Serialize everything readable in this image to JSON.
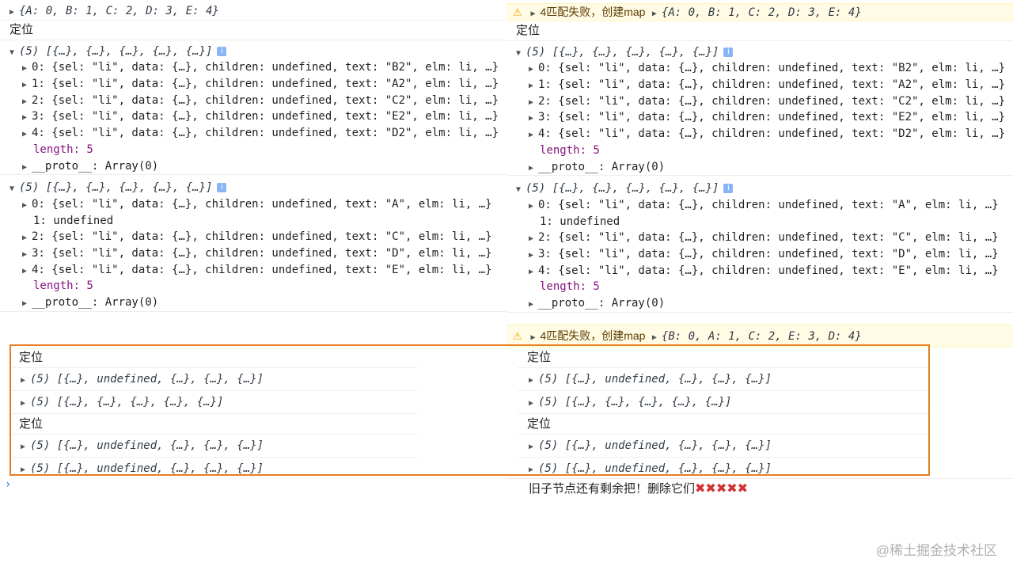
{
  "label_locate": "定位",
  "left": {
    "top_object": "{A: 0, B: 1, C: 2, D: 3, E: 4}",
    "array1": {
      "header": "(5) [{…}, {…}, {…}, {…}, {…}]",
      "items": [
        "0: {sel: \"li\", data: {…}, children: undefined, text: \"B2\", elm: li, …}",
        "1: {sel: \"li\", data: {…}, children: undefined, text: \"A2\", elm: li, …}",
        "2: {sel: \"li\", data: {…}, children: undefined, text: \"C2\", elm: li, …}",
        "3: {sel: \"li\", data: {…}, children: undefined, text: \"E2\", elm: li, …}",
        "4: {sel: \"li\", data: {…}, children: undefined, text: \"D2\", elm: li, …}"
      ],
      "length": "length: 5",
      "proto": "__proto__: Array(0)"
    },
    "array2": {
      "header": "(5) [{…}, {…}, {…}, {…}, {…}]",
      "items": [
        "0: {sel: \"li\", data: {…}, children: undefined, text: \"A\", elm: li, …}",
        "1: undefined",
        "2: {sel: \"li\", data: {…}, children: undefined, text: \"C\", elm: li, …}",
        "3: {sel: \"li\", data: {…}, children: undefined, text: \"D\", elm: li, …}",
        "4: {sel: \"li\", data: {…}, children: undefined, text: \"E\", elm: li, …}"
      ],
      "length": "length: 5",
      "proto": "__proto__: Array(0)"
    },
    "bottom": [
      "(5) [{…}, undefined, {…}, {…}, {…}]",
      "(5) [{…}, {…}, {…}, {…}, {…}]",
      "(5) [{…}, undefined, {…}, {…}, {…}]",
      "(5) [{…}, undefined, {…}, {…}, {…}]"
    ]
  },
  "right": {
    "warn1_text": "4匹配失败，创建map",
    "warn1_object": "{A: 0, B: 1, C: 2, D: 3, E: 4}",
    "array1": {
      "header": "(5) [{…}, {…}, {…}, {…}, {…}]",
      "items": [
        "0: {sel: \"li\", data: {…}, children: undefined, text: \"B2\", elm: li, …}",
        "1: {sel: \"li\", data: {…}, children: undefined, text: \"A2\", elm: li, …}",
        "2: {sel: \"li\", data: {…}, children: undefined, text: \"C2\", elm: li, …}",
        "3: {sel: \"li\", data: {…}, children: undefined, text: \"E2\", elm: li, …}",
        "4: {sel: \"li\", data: {…}, children: undefined, text: \"D2\", elm: li, …}"
      ],
      "length": "length: 5",
      "proto": "__proto__: Array(0)"
    },
    "array2": {
      "header": "(5) [{…}, {…}, {…}, {…}, {…}]",
      "items": [
        "0: {sel: \"li\", data: {…}, children: undefined, text: \"A\", elm: li, …}",
        "1: undefined",
        "2: {sel: \"li\", data: {…}, children: undefined, text: \"C\", elm: li, …}",
        "3: {sel: \"li\", data: {…}, children: undefined, text: \"D\", elm: li, …}",
        "4: {sel: \"li\", data: {…}, children: undefined, text: \"E\", elm: li, …}"
      ],
      "length": "length: 5",
      "proto": "__proto__: Array(0)"
    },
    "warn2_text": "4匹配失败，创建map",
    "warn2_object": "{B: 0, A: 1, C: 2, E: 3, D: 4}",
    "bottom": [
      "(5) [{…}, undefined, {…}, {…}, {…}]",
      "(5) [{…}, {…}, {…}, {…}, {…}]",
      "(5) [{…}, undefined, {…}, {…}, {…}]",
      "(5) [{…}, undefined, {…}, {…}, {…}]"
    ],
    "final_message": "旧子节点还有剩余把！删除它们",
    "final_marks": "✖✖✖✖✖"
  },
  "console_prompt": "›",
  "watermark": "@稀土掘金技术社区",
  "colors": {
    "highlight": "#e67e22",
    "warning_bg": "#fffbe5",
    "prompt": "#1a73e8"
  }
}
